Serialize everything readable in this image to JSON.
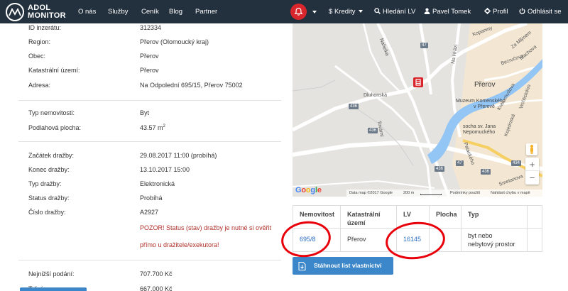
{
  "navbar": {
    "logo_line1": "ADOL",
    "logo_line2": "MONITOR",
    "items": [
      "O nás",
      "Služby",
      "Ceník",
      "Blog",
      "Partner"
    ],
    "credits": "Kredity",
    "search_lv": "Hledání LV",
    "user": "Pavel Tomek",
    "profile": "Profil",
    "logout": "Odhlásit se"
  },
  "details": {
    "id_label": "ID inzerátu:",
    "id_value": "312334",
    "region_label": "Region:",
    "region_value": "Přerov (Olomoucký kraj)",
    "obec_label": "Obec:",
    "obec_value": "Přerov",
    "katastr_label": "Katastrální území:",
    "katastr_value": "Přerov",
    "adresa_label": "Adresa:",
    "adresa_value": "Na Odpolední 695/15, Přerov 75002",
    "typ_label": "Typ nemovitosti:",
    "typ_value": "Byt",
    "plocha_label": "Podlahová plocha:",
    "plocha_value": "43.57 m",
    "plocha_unit_sup": "2",
    "zacatek_label": "Začátek dražby:",
    "zacatek_value": "29.08.2017 11:00 (probíhá)",
    "konec_label": "Konec dražby:",
    "konec_value": "13.10.2017 15:00",
    "typ_drazby_label": "Typ dražby:",
    "typ_drazby_value": "Elektronická",
    "status_label": "Status dražby:",
    "status_value": "Probíhá",
    "cislo_label": "Číslo dražby:",
    "cislo_value": "A2927",
    "warning_line1": "POZOR! Status (stav) dražby je nutné si ověřit",
    "warning_line2": "přímo u dražitele/exekutora!",
    "nejnizsi_label": "Nejnižší podání:",
    "nejnizsi_value": "707.700 Kč",
    "next_label": "Tržní cena:",
    "next_value": "667.000 Kč"
  },
  "map": {
    "labels": {
      "kopaniny": "Kopaniny",
      "nahelka": "Nahelka",
      "dluhonska": "Dluhonská",
      "prerov": "Přerov",
      "muzeum1": "Muzeum Komenského",
      "muzeum2": "v Přerově",
      "socha1": "socha sv. Jana",
      "socha2": "Nepomuckého",
      "kojetinska": "Kojetínská",
      "tovarni": "Tovární",
      "kratochvilova": "Kratochvílova",
      "bezrucova": "Bezručova",
      "zamyslem": "Za Mlýnem",
      "machova": "Machova",
      "smetanova": "Smetanova",
      "palackeho": "Palackého",
      "na_hrazi": "Na Hrázi",
      "vrchlickeho": "Vrchlického"
    },
    "shields": [
      "47",
      "436",
      "436",
      "436",
      "47",
      "436",
      "434"
    ],
    "google": [
      "G",
      "o",
      "o",
      "g",
      "l",
      "e"
    ],
    "footer_data": "Data map ©2017 Google",
    "footer_scale": "200 m",
    "footer_terms": "Podmínky použití",
    "footer_report": "Nahlásit chybu v mapě",
    "zoom_in": "+",
    "zoom_out": "−",
    "colors": {
      "water": "#93c5f5",
      "road": "#ffffff",
      "highway": "#f6cf63",
      "land": "#e5e3df",
      "urban": "#f3e7d3",
      "marker": "#d9262c"
    }
  },
  "table": {
    "headers": [
      "Nemovitost",
      "Katastrální území",
      "LV",
      "Plocha",
      "Typ"
    ],
    "header_katastr_line1": "Katastrální",
    "header_katastr_line2": "území",
    "row": {
      "nemovitost": "695/8",
      "katastr": "Přerov",
      "lv": "16145",
      "plocha": "",
      "typ_line1": "byt nebo",
      "typ_line2": "nebytový prostor"
    }
  },
  "download_button": "Stáhnout list vlastnictví",
  "colors": {
    "navbar": "#23303e",
    "accent": "#3b87c9",
    "link": "#2a6ec2",
    "warning": "#b0302a",
    "annotation": "#e8000b",
    "bell": "#d9262c"
  }
}
